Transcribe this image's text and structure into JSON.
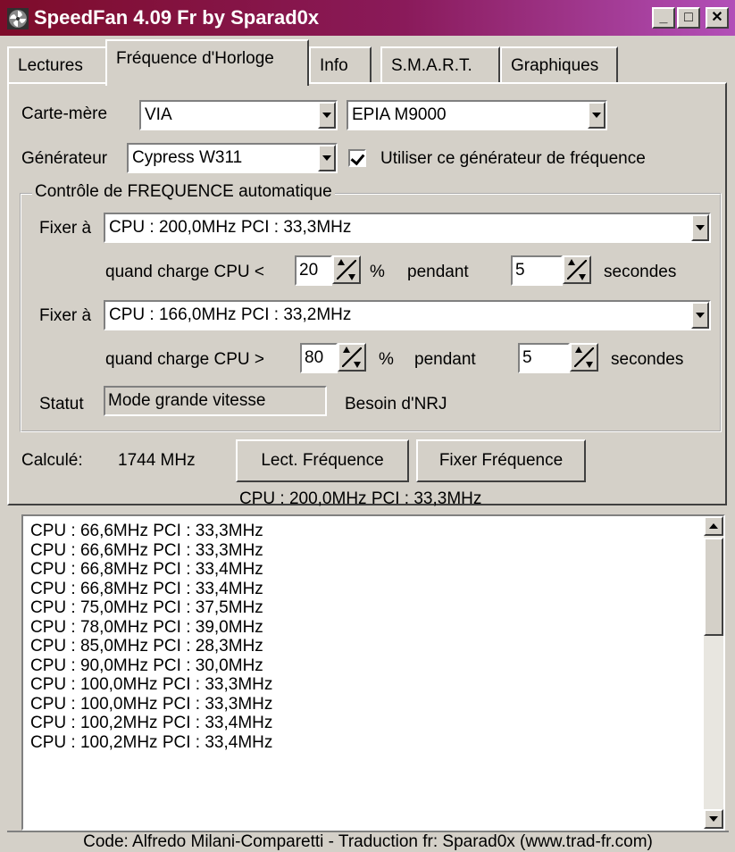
{
  "window": {
    "title": "SpeedFan 4.09 Fr by Sparad0x",
    "title_color": "#ffffff",
    "minimize": "_",
    "maximize": "□",
    "close": "✕"
  },
  "tabs": [
    "Lectures",
    "Fréquence d'Horloge",
    "Info",
    "S.M.A.R.T.",
    "Graphiques"
  ],
  "active_tab": "Fréquence d'Horloge",
  "motherboard": {
    "label": "Carte-mère",
    "vendor": "VIA",
    "model": "EPIA M9000"
  },
  "generator": {
    "label": "Générateur",
    "value": "Cypress W311",
    "use_checkbox_label": "Utiliser ce générateur de fréquence",
    "use_checked": true
  },
  "auto_control": {
    "group_title": "Contrôle de FREQUENCE automatique",
    "rule1": {
      "fix_label": "Fixer à",
      "fix_value": "CPU : 200,0MHz  PCI : 33,3MHz",
      "when_label": "quand charge CPU <",
      "threshold": "20",
      "percent": "%",
      "during_label": "pendant",
      "duration": "5",
      "unit": "secondes"
    },
    "rule2": {
      "fix_label": "Fixer à",
      "fix_value": "CPU : 166,0MHz  PCI : 33,2MHz",
      "when_label": "quand charge CPU >",
      "threshold": "80",
      "percent": "%",
      "during_label": "pendant",
      "duration": "5",
      "unit": "secondes"
    },
    "status_label": "Statut",
    "status_value": "Mode grande vitesse",
    "status_extra": "Besoin d'NRJ"
  },
  "calculated": {
    "label": "Calculé:",
    "value": "1744 MHz"
  },
  "buttons": {
    "read": "Lect. Fréquence",
    "set": "Fixer Fréquence"
  },
  "current_frequency": "CPU : 200,0MHz  PCI : 33,3MHz",
  "frequency_list": [
    "CPU : 66,6MHz  PCI : 33,3MHz",
    "CPU : 66,6MHz  PCI : 33,3MHz",
    "CPU : 66,8MHz  PCI : 33,4MHz",
    "CPU : 66,8MHz  PCI : 33,4MHz",
    "CPU : 75,0MHz  PCI : 37,5MHz",
    "CPU : 78,0MHz  PCI : 39,0MHz",
    "CPU : 85,0MHz  PCI : 28,3MHz",
    "CPU : 90,0MHz  PCI : 30,0MHz",
    "CPU : 100,0MHz  PCI : 33,3MHz",
    "CPU : 100,0MHz  PCI : 33,3MHz",
    "CPU : 100,2MHz  PCI : 33,4MHz",
    "CPU : 100,2MHz  PCI : 33,4MHz"
  ],
  "status_bar": "Code: Alfredo Milani-Comparetti - Traduction fr: Sparad0x (www.trad-fr.com)",
  "colors": {
    "face": "#d4d0c8",
    "title_gradient_start": "#7e0c2a",
    "title_gradient_end": "#b24fb8"
  },
  "icons": {
    "app": "fan-icon",
    "combo": "chevron-down-icon",
    "spinner": "spin-arrows-icon",
    "scroll_up": "arrow-up-icon",
    "scroll_down": "arrow-down-icon"
  }
}
